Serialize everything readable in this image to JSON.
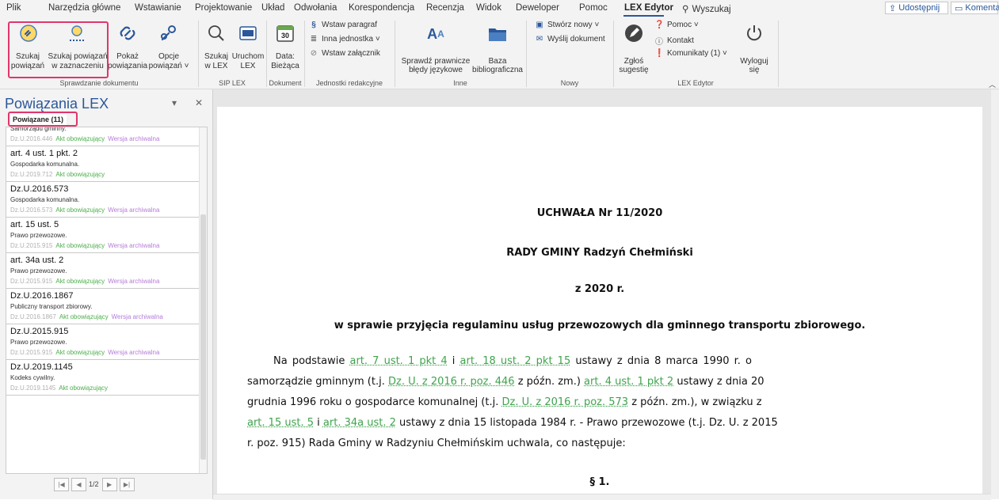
{
  "menu": {
    "items": [
      "Plik",
      "Narzędzia główne",
      "Wstawianie",
      "Projektowanie",
      "Układ",
      "Odwołania",
      "Korespondencja",
      "Recenzja",
      "Widok",
      "Deweloper",
      "Pomoc",
      "LEX Edytor"
    ],
    "search_label": "Wyszukaj",
    "share_label": "Udostępnij",
    "comments_label": "Komentarze",
    "accent": "#2b579a"
  },
  "ribbon": {
    "szukaj_powiazan": [
      "Szukaj",
      "powiązań"
    ],
    "szukaj_w_zaznaczeniu": [
      "Szukaj powiązań",
      "w zaznaczeniu"
    ],
    "pokaz_powiazania": [
      "Pokaż",
      "powiązania"
    ],
    "opcje_powiazan": [
      "Opcje",
      "powiązań ˅"
    ],
    "group_sprawdzanie": "Sprawdzanie dokumentu",
    "szukaj_w_lex": [
      "Szukaj",
      "w LEX"
    ],
    "uruchom_lex": [
      "Uruchom",
      "LEX"
    ],
    "group_sip": "SIP LEX",
    "calendar_day": "30",
    "data_biezaca": [
      "Data:",
      "Bieżąca"
    ],
    "group_dokument": "Dokument",
    "wstaw_paragraf": "Wstaw paragraf",
    "inna_jednostka": "Inna jednostka ˅",
    "wstaw_zalacznik": "Wstaw załącznik",
    "group_jednostki": "Jednostki redakcyjne",
    "sprawdz_prawnicze": [
      "Sprawdź prawnicze",
      "błędy językowe"
    ],
    "baza_bibliograficzna": [
      "Baza",
      "bibliograficzna"
    ],
    "group_inne": "Inne",
    "stworz_nowy": "Stwórz nowy ˅",
    "wyslij_dokument": "Wyślij dokument",
    "group_nowy": "Nowy",
    "zglos_sugestie": [
      "Zgłoś",
      "sugestię"
    ],
    "pomoc": "Pomoc ˅",
    "kontakt": "Kontakt",
    "komunikaty": "Komunikaty (1) ˅",
    "wyloguj": [
      "Wyloguj",
      "się"
    ],
    "group_lex_edytor": "LEX Edytor",
    "highlight_color": "#e0366b"
  },
  "pane": {
    "title": "Powiązania LEX",
    "tab_label": "Powiązane (11)",
    "items": [
      {
        "title": "",
        "subtitle": "Samorządu gminny.",
        "ref": "Dz.U.2016.446",
        "status": "Akt obowiązujący",
        "archive": "Wersja archiwalna"
      },
      {
        "title": "art. 4 ust. 1 pkt. 2",
        "subtitle": "Gospodarka komunalna.",
        "ref": "Dz.U.2019.712",
        "status": "Akt obowiązujący",
        "archive": ""
      },
      {
        "title": "Dz.U.2016.573",
        "subtitle": "Gospodarka komunalna.",
        "ref": "Dz.U.2016.573",
        "status": "Akt obowiązujący",
        "archive": "Wersja archiwalna"
      },
      {
        "title": "art. 15 ust. 5",
        "subtitle": "Prawo przewozowe.",
        "ref": "Dz.U.2015.915",
        "status": "Akt obowiązujący",
        "archive": "Wersja archiwalna"
      },
      {
        "title": "art. 34a ust. 2",
        "subtitle": "Prawo przewozowe.",
        "ref": "Dz.U.2015.915",
        "status": "Akt obowiązujący",
        "archive": "Wersja archiwalna"
      },
      {
        "title": "Dz.U.2016.1867",
        "subtitle": "Publiczny transport zbiorowy.",
        "ref": "Dz.U.2016.1867",
        "status": "Akt obowiązujący",
        "archive": "Wersja archiwalna"
      },
      {
        "title": "Dz.U.2015.915",
        "subtitle": "Prawo przewozowe.",
        "ref": "Dz.U.2015.915",
        "status": "Akt obowiązujący",
        "archive": "Wersja archiwalna"
      },
      {
        "title": "Dz.U.2019.1145",
        "subtitle": "Kodeks cywilny.",
        "ref": "Dz.U.2019.1145",
        "status": "Akt obowiązujący",
        "archive": ""
      }
    ],
    "page_info": "1/2",
    "status_color": "#4cae4c",
    "archive_color": "#b57bd9"
  },
  "document": {
    "title1": "UCHWAŁA Nr 11/2020",
    "title2": "RADY GMINY Radzyń Chełmiński",
    "title3": "z 2020 r.",
    "title4": "w sprawie przyjęcia regulaminu usług przewozowych dla gminnego transportu zbiorowego.",
    "l1_a": "Na podstawie",
    "l1_link1": "art. 7 ust. 1 pkt 4",
    "l1_b": "i",
    "l1_link2": "art. 18 ust. 2 pkt 15",
    "l1_c": "ustawy z dnia 8 marca 1990 r. o",
    "l2_a": "samorządzie gminnym (t.j.",
    "l2_link1": "Dz. U. z 2016 r. poz. 446",
    "l2_b": "z późn. zm.)",
    "l2_link2": "art. 4 ust. 1 pkt 2",
    "l2_c": "ustawy z dnia 20",
    "l3_a": "grudnia 1996 roku o gospodarce komunalnej (t.j.",
    "l3_link1": "Dz. U. z 2016 r. poz. 573",
    "l3_b": "z późn. zm.), w związku z",
    "l4_link1": "art. 15 ust. 5",
    "l4_a": "i",
    "l4_link2": "art. 34a ust. 2",
    "l4_b": "ustawy z dnia 15 listopada 1984 r. - Prawo przewozowe (t.j. Dz. U. z 2015",
    "l5": "r. poz. 915) Rada Gminy w Radzyniu Chełmińskim uchwala, co następuje:",
    "section": "§ 1.",
    "link_color": "#3fa34d"
  }
}
